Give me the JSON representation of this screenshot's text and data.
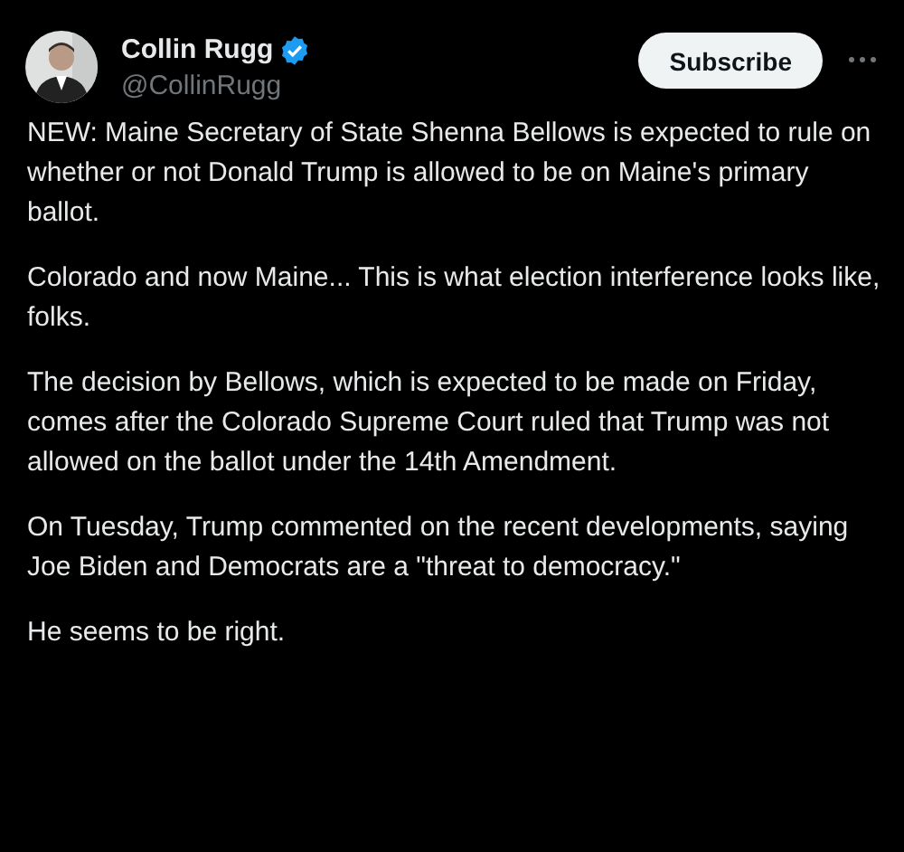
{
  "author": {
    "name": "Collin Rugg",
    "verified": true,
    "handle": "@CollinRugg"
  },
  "subscribe_button": "Subscribe",
  "paragraphs": [
    "NEW: Maine Secretary of State Shenna Bellows is expected to rule on whether or not Donald Trump is allowed to be on Maine's primary ballot.",
    "Colorado and now Maine... This is what election interference looks like, folks.",
    "The decision by Bellows, which is expected to be made on Friday, comes after the Colorado Supreme Court ruled that Trump was not allowed on the ballot under the 14th Amendment.",
    "On Tuesday, Trump commented on the recent developments, saying Joe Biden and Democrats are a \"threat to democracy.\"",
    "He seems to be right."
  ]
}
